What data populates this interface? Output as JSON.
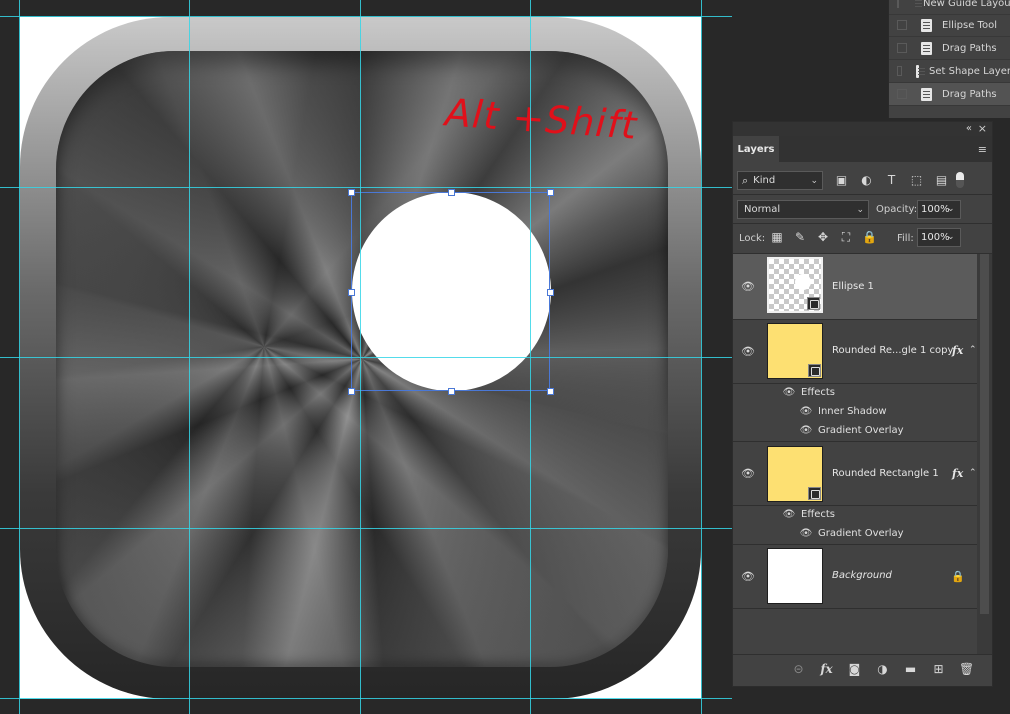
{
  "annotation": {
    "text": "Alt +Shift"
  },
  "history_panel": {
    "items": [
      {
        "label": "New Guide Layout",
        "icon": "history-state-icon",
        "active": false
      },
      {
        "label": "Ellipse Tool",
        "icon": "history-state-icon",
        "active": false
      },
      {
        "label": "Drag Paths",
        "icon": "history-state-icon",
        "active": false
      },
      {
        "label": "Set Shape Layer",
        "icon": "history-state-icon",
        "active": false
      },
      {
        "label": "Drag Paths",
        "icon": "history-state-icon",
        "active": true
      }
    ]
  },
  "layers_panel": {
    "tab": "Layers",
    "collapse_glyph": "«",
    "close_glyph": "×",
    "menu_glyph": "≡",
    "filter": {
      "kind_label": "Kind",
      "icons": [
        "pixel-filter-icon",
        "adjustment-filter-icon",
        "type-filter-icon",
        "shape-filter-icon",
        "smart-object-filter-icon"
      ],
      "glyphs": [
        "▣",
        "◐",
        "T",
        "⬚",
        "▤"
      ]
    },
    "blend_mode": "Normal",
    "opacity_label": "Opacity:",
    "opacity_value": "100%",
    "lock_label": "Lock:",
    "lock_glyphs": [
      "▦",
      "✎",
      "✥",
      "⛶",
      "🔒"
    ],
    "fill_label": "Fill:",
    "fill_value": "100%",
    "layers": [
      {
        "name": "Ellipse 1",
        "selected": true,
        "thumb": "checker",
        "fx": false
      },
      {
        "name": "Rounded Re...gle 1 copy",
        "selected": false,
        "thumb": "yellow",
        "fx": true,
        "effects_label": "Effects",
        "effects": [
          "Inner Shadow",
          "Gradient Overlay"
        ]
      },
      {
        "name": "Rounded Rectangle 1",
        "selected": false,
        "thumb": "yellow",
        "fx": true,
        "effects_label": "Effects",
        "effects": [
          "Gradient Overlay"
        ]
      },
      {
        "name": "Background",
        "selected": false,
        "thumb": "white",
        "fx": false,
        "locked": true
      }
    ],
    "fx_label": "fx",
    "footer_glyphs": [
      "⊝",
      "fx",
      "◙",
      "◑",
      "▬",
      "⊞",
      "🗑"
    ]
  },
  "colors": {
    "guide": "#35d6e8",
    "annotation": "#e0101a",
    "panel_bg": "#424242",
    "selected_row": "#5b5b5b",
    "shape_fill": "#fde072"
  }
}
